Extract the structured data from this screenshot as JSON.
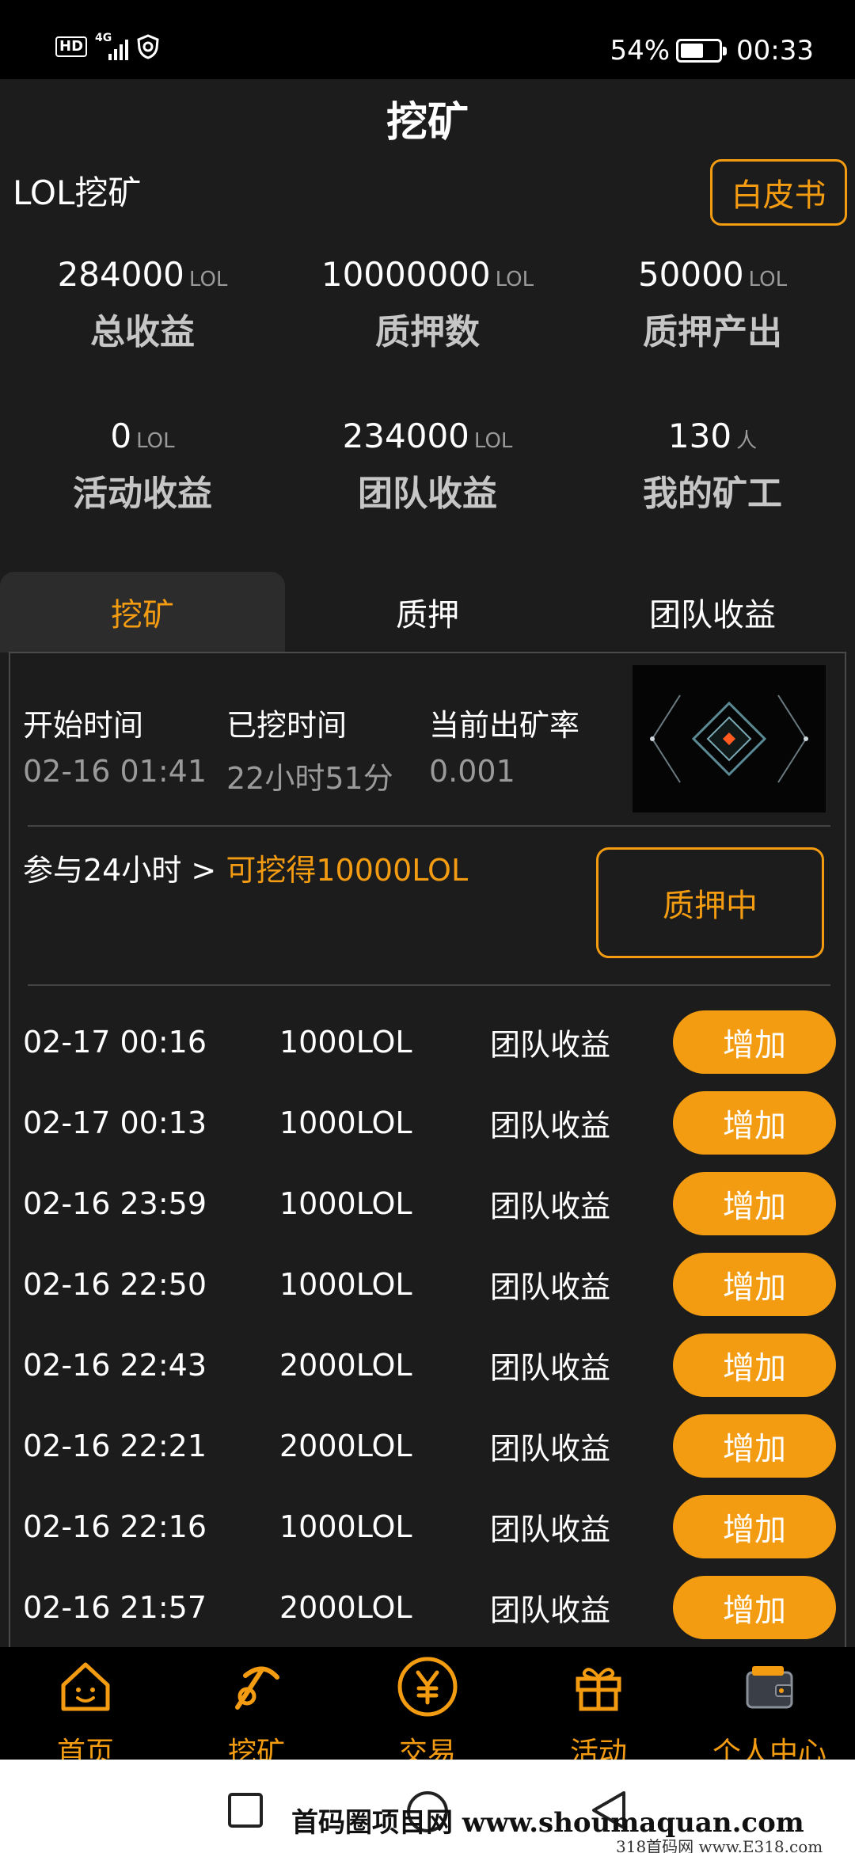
{
  "status_bar": {
    "hd": "HD",
    "network": "4G",
    "battery": "54%",
    "battery_level": 0.54,
    "time": "00:33"
  },
  "header": {
    "title": "挖矿",
    "section_title": "LOL挖矿",
    "whitepaper_label": "白皮书"
  },
  "stats": [
    {
      "value": "284000",
      "unit": "LOL",
      "label": "总收益"
    },
    {
      "value": "10000000",
      "unit": "LOL",
      "label": "质押数"
    },
    {
      "value": "50000",
      "unit": "LOL",
      "label": "质押产出"
    },
    {
      "value": "0",
      "unit": "LOL",
      "label": "活动收益"
    },
    {
      "value": "234000",
      "unit": "LOL",
      "label": "团队收益"
    },
    {
      "value": "130",
      "unit": "人",
      "label": "我的矿工"
    }
  ],
  "tabs": [
    {
      "label": "挖矿",
      "active": true
    },
    {
      "label": "质押",
      "active": false
    },
    {
      "label": "团队收益",
      "active": false
    }
  ],
  "mining": {
    "start_time_label": "开始时间",
    "start_time_value": "02-16 01:41",
    "elapsed_label": "已挖时间",
    "elapsed_value": "22小时51分",
    "rate_label": "当前出矿率",
    "rate_value": "0.001",
    "join_text": "参与24小时 > ",
    "join_highlight": "可挖得10000LOL",
    "pledge_button": "质押中"
  },
  "records": [
    {
      "time": "02-17 00:16",
      "amount": "1000LOL",
      "type": "团队收益",
      "action": "增加"
    },
    {
      "time": "02-17 00:13",
      "amount": "1000LOL",
      "type": "团队收益",
      "action": "增加"
    },
    {
      "time": "02-16 23:59",
      "amount": "1000LOL",
      "type": "团队收益",
      "action": "增加"
    },
    {
      "time": "02-16 22:50",
      "amount": "1000LOL",
      "type": "团队收益",
      "action": "增加"
    },
    {
      "time": "02-16 22:43",
      "amount": "2000LOL",
      "type": "团队收益",
      "action": "增加"
    },
    {
      "time": "02-16 22:21",
      "amount": "2000LOL",
      "type": "团队收益",
      "action": "增加"
    },
    {
      "time": "02-16 22:16",
      "amount": "1000LOL",
      "type": "团队收益",
      "action": "增加"
    },
    {
      "time": "02-16 21:57",
      "amount": "2000LOL",
      "type": "团队收益",
      "action": "增加"
    }
  ],
  "bottom_nav": [
    {
      "label": "首页",
      "icon": "home-icon"
    },
    {
      "label": "挖矿",
      "icon": "pickaxe-icon"
    },
    {
      "label": "交易",
      "icon": "yuan-icon"
    },
    {
      "label": "活动",
      "icon": "gift-icon"
    },
    {
      "label": "个人中心",
      "icon": "wallet-icon"
    }
  ],
  "watermark": {
    "main": "首码圈项目网 www.shoumaquan.com",
    "secondary": "318首码网 www.E318.com"
  },
  "colors": {
    "accent": "#f39c12",
    "background": "#1c1c1c"
  }
}
